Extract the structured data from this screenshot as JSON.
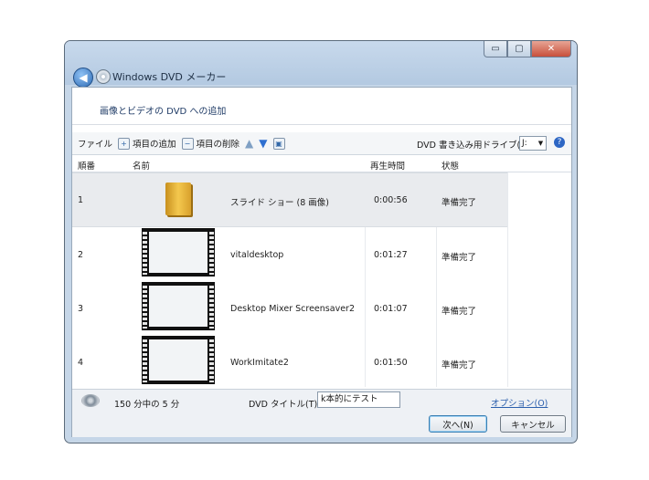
{
  "window": {
    "title": "Windows DVD メーカー"
  },
  "caption": {
    "minimize": "▭",
    "maximize": "▢",
    "close": "✕"
  },
  "header": {
    "text": "画像とビデオの DVD への追加"
  },
  "toolbar": {
    "file": "ファイル",
    "add": "項目の追加",
    "remove": "項目の削除",
    "drive_label": "DVD 書き込み用ドライブ(D):",
    "drive_value": "J:",
    "help": "?"
  },
  "columns": {
    "order": "順番",
    "name": "名前",
    "duration": "再生時間",
    "status": "状態"
  },
  "items": [
    {
      "order": "1",
      "name": "スライド ショー (8 画像)",
      "duration": "0:00:56",
      "status": "準備完了",
      "kind": "folder"
    },
    {
      "order": "2",
      "name": "vitaldesktop",
      "duration": "0:01:27",
      "status": "準備完了",
      "kind": "video"
    },
    {
      "order": "3",
      "name": "Desktop Mixer Screensaver2",
      "duration": "0:01:07",
      "status": "準備完了",
      "kind": "video"
    },
    {
      "order": "4",
      "name": "WorkImitate2",
      "duration": "0:01:50",
      "status": "準備完了",
      "kind": "video"
    }
  ],
  "footer": {
    "count": "150 分中の 5 分",
    "title_label": "DVD タイトル(T):",
    "title_value": "k本的にテスト",
    "options": "オプション(O)",
    "next": "次へ(N)",
    "cancel": "キャンセル"
  },
  "colors": {
    "accent": "#2d66c4",
    "selected_row": "#e9ebee",
    "header_text": "#1f3b66"
  },
  "icons": [
    "back-arrow-icon",
    "dvd-maker-icon",
    "add-item-icon",
    "remove-item-icon",
    "move-up-icon",
    "move-down-icon",
    "burn-icon",
    "help-icon",
    "disc-icon"
  ]
}
